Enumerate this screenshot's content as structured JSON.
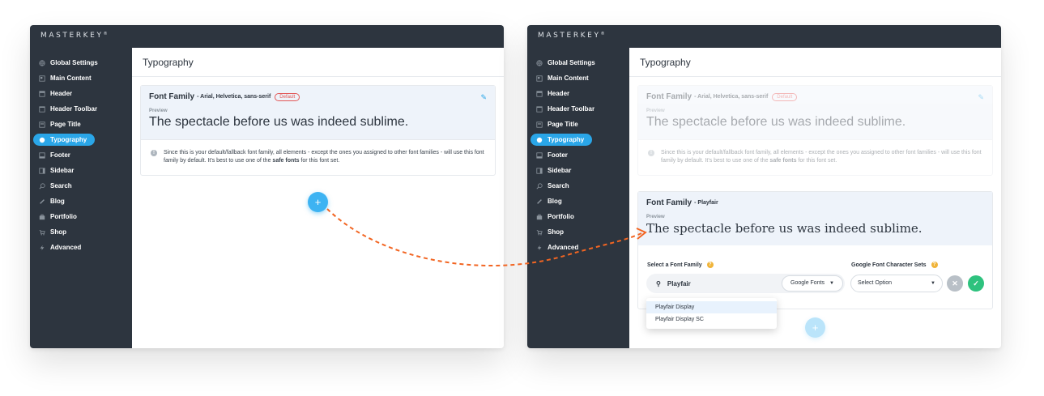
{
  "brand": "MASTERKEY",
  "brand_mark": "®",
  "nav": [
    {
      "label": "Global Settings",
      "icon": "globe-icon"
    },
    {
      "label": "Main Content",
      "icon": "layout-icon"
    },
    {
      "label": "Header",
      "icon": "header-icon"
    },
    {
      "label": "Header Toolbar",
      "icon": "toolbar-icon"
    },
    {
      "label": "Page Title",
      "icon": "page-title-icon"
    },
    {
      "label": "Typography",
      "icon": "typography-icon"
    },
    {
      "label": "Footer",
      "icon": "footer-icon"
    },
    {
      "label": "Sidebar",
      "icon": "sidebar-icon"
    },
    {
      "label": "Search",
      "icon": "search-icon"
    },
    {
      "label": "Blog",
      "icon": "pencil-icon"
    },
    {
      "label": "Portfolio",
      "icon": "briefcase-icon"
    },
    {
      "label": "Shop",
      "icon": "cart-icon"
    },
    {
      "label": "Advanced",
      "icon": "bolt-icon"
    }
  ],
  "active_nav": "Typography",
  "page_title": "Typography",
  "default_card": {
    "title": "Font Family",
    "fonts": "- Arial, Helvetica, sans-serif",
    "badge": "Default",
    "preview_label": "Preview",
    "preview_text": "The spectacle before us was indeed sublime.",
    "note_before": "Since this is your default/fallback font family, all elements - except the ones you assigned to other font families - will use this font family by default. It's best to use one of the ",
    "note_bold": "safe fonts",
    "note_after": " for this font set."
  },
  "new_card": {
    "title": "Font Family",
    "fonts": "- Playfair",
    "preview_label": "Preview",
    "preview_text": "The spectacle before us was indeed sublime.",
    "select_label": "Select a Font Family",
    "charset_label": "Google Font Character Sets",
    "search_value": "Playfair",
    "source_button": "Google Fonts",
    "charset_placeholder": "Select Option",
    "suggestions": [
      "Playfair Display",
      "Playfair Display SC"
    ]
  },
  "add_label": "+",
  "colors": {
    "sidebar": "#2d353f",
    "accent": "#2aa6e8",
    "add_button": "#3db3f2",
    "confirm": "#2ec27e",
    "cancel": "#b9c0c7",
    "connector": "#f26522",
    "badge": "#e25757"
  }
}
